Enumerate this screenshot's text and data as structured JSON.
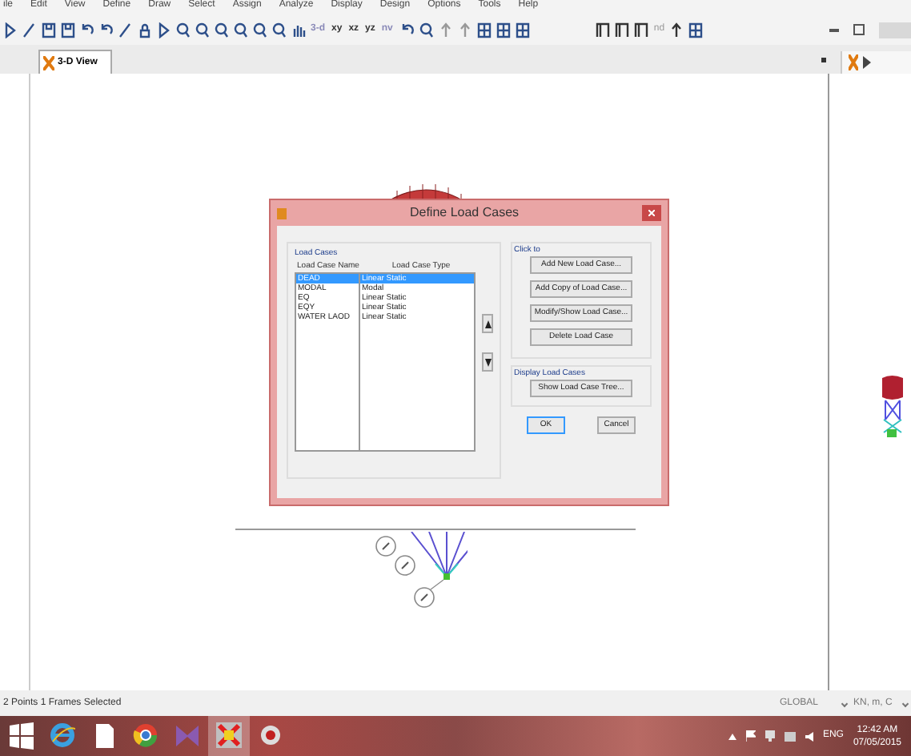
{
  "menu_bar": [
    "ile",
    "Edit",
    "View",
    "Define",
    "Draw",
    "Select",
    "Assign",
    "Analyze",
    "Display",
    "Design",
    "Options",
    "Tools",
    "Help"
  ],
  "toolbar": {
    "view_buttons": [
      "3-d",
      "xy",
      "xz",
      "yz",
      "nv"
    ],
    "right_label": "nd"
  },
  "tabs": [
    {
      "label": "3-D View",
      "selected": true
    }
  ],
  "dialog": {
    "title": "Define Load Cases",
    "load_cases": {
      "title": "Load Cases",
      "columns": [
        "Load Case Name",
        "Load Case Type"
      ],
      "rows": [
        {
          "name": "DEAD",
          "type": "Linear Static",
          "selected": true
        },
        {
          "name": "MODAL",
          "type": "Modal",
          "selected": false
        },
        {
          "name": "EQ",
          "type": "Linear Static",
          "selected": false
        },
        {
          "name": "EQY",
          "type": "Linear Static",
          "selected": false
        },
        {
          "name": "WATER LAOD",
          "type": "Linear Static",
          "selected": false
        }
      ]
    },
    "click_to": {
      "title": "Click to",
      "buttons": [
        "Add New Load Case...",
        "Add Copy of Load Case...",
        "Modify/Show Load Case...",
        "Delete Load Case"
      ]
    },
    "display": {
      "title": "Display Load Cases",
      "button": "Show Load Case Tree..."
    },
    "buttons": [
      "OK",
      "Cancel"
    ]
  },
  "status_bar": {
    "text": "2 Points  1 Frames Selected",
    "coordinates": "GLOBAL",
    "units": "KN, m, C"
  },
  "taskbar": {
    "language": "ENG",
    "time": "12:42 AM",
    "date": "07/05/2015"
  }
}
